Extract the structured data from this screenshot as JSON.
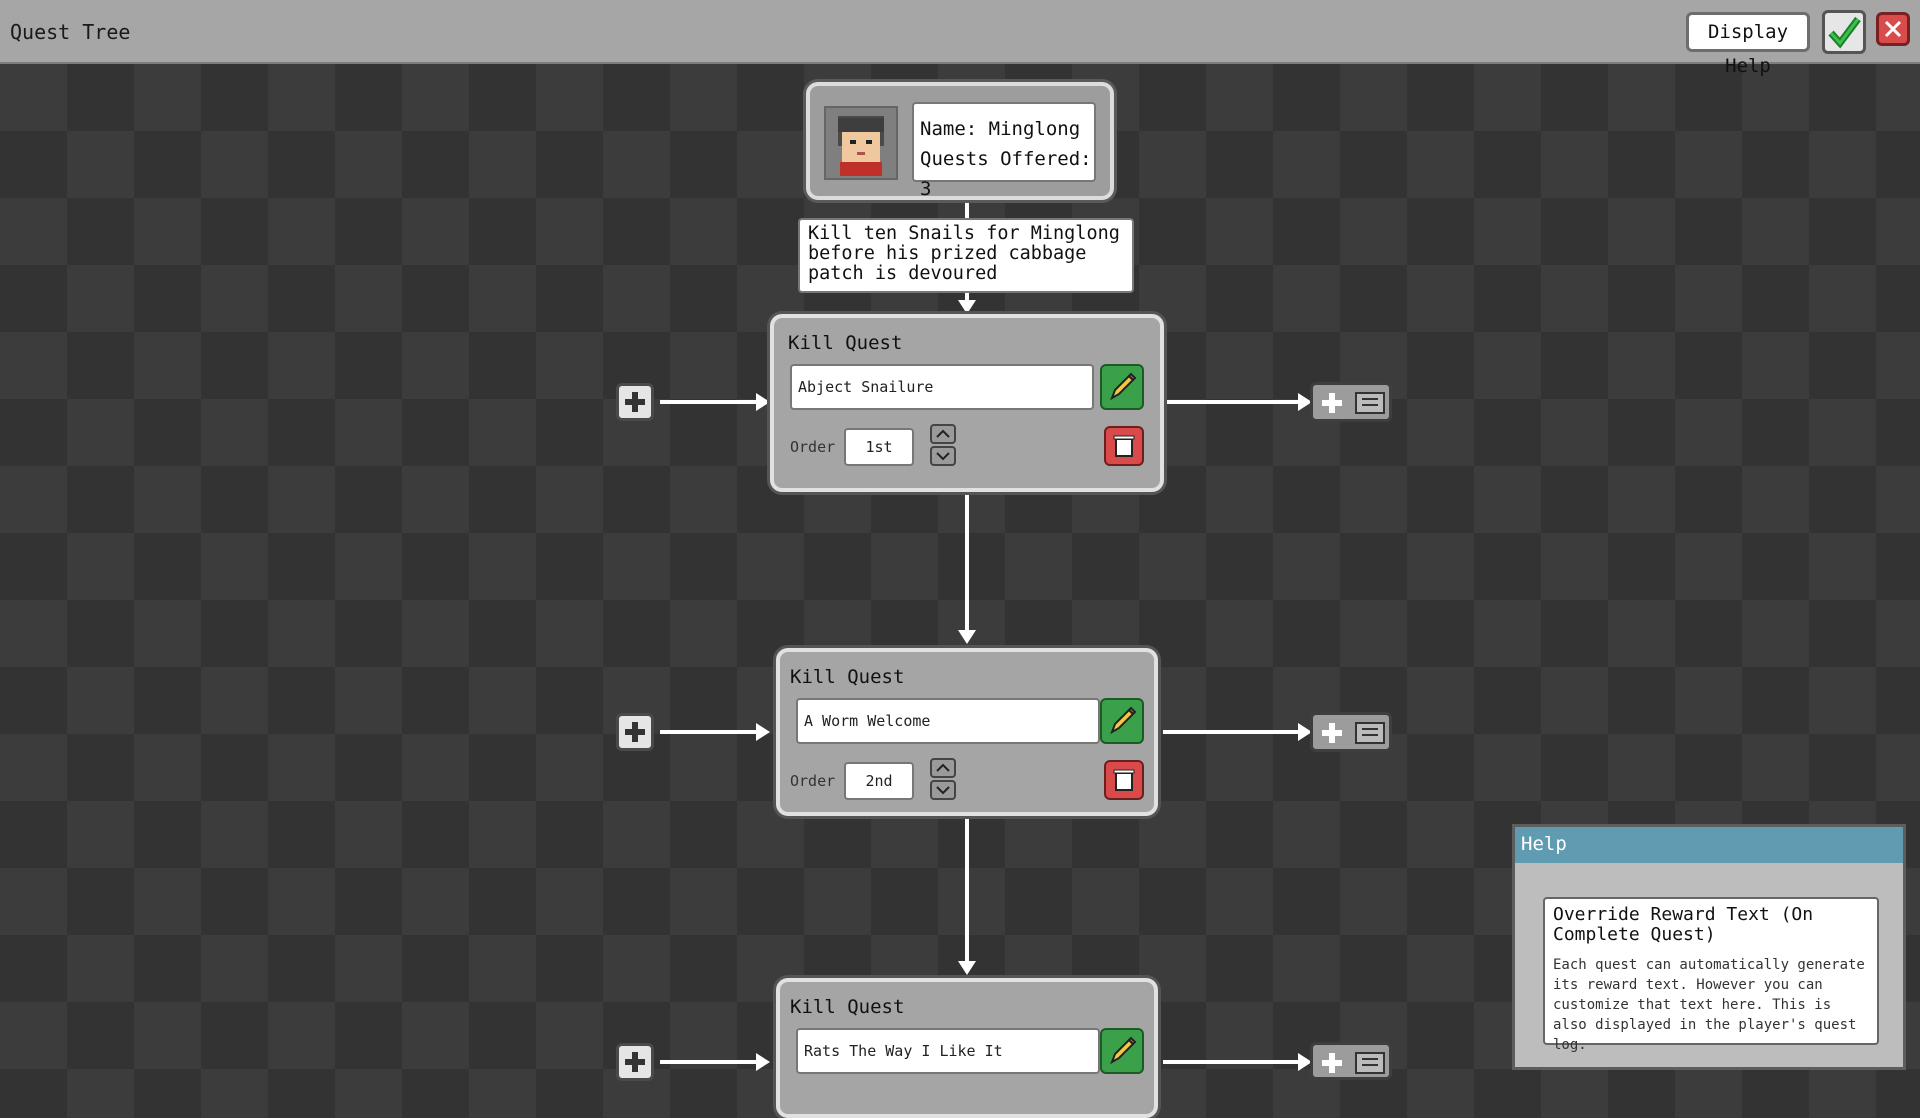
{
  "window": {
    "title": "Quest Tree"
  },
  "toolbar": {
    "display_help_label": "Display Help",
    "confirm_icon": "check-icon",
    "close_icon": "close-icon"
  },
  "npc": {
    "name_line": "Name: Minglong",
    "quests_line": "Quests Offered: 3"
  },
  "description": "Kill ten Snails for Minglong before his prized cabbage patch is devoured",
  "quests": [
    {
      "type": "Kill Quest",
      "name": "Abject Snailure",
      "order_label": "Order",
      "order": "1st"
    },
    {
      "type": "Kill Quest",
      "name": "A Worm Welcome",
      "order_label": "Order",
      "order": "2nd"
    },
    {
      "type": "Kill Quest",
      "name": "Rats The Way I Like It"
    }
  ],
  "help": {
    "header": "Help",
    "title": "Override Reward Text (On Complete Quest)",
    "text": "Each quest can automatically generate its reward text. However you can customize that text here. This is also displayed in the player's quest log."
  },
  "colors": {
    "help_header": "#5f9bb1",
    "edit": "#3aa04a",
    "delete": "#d94b4b"
  }
}
